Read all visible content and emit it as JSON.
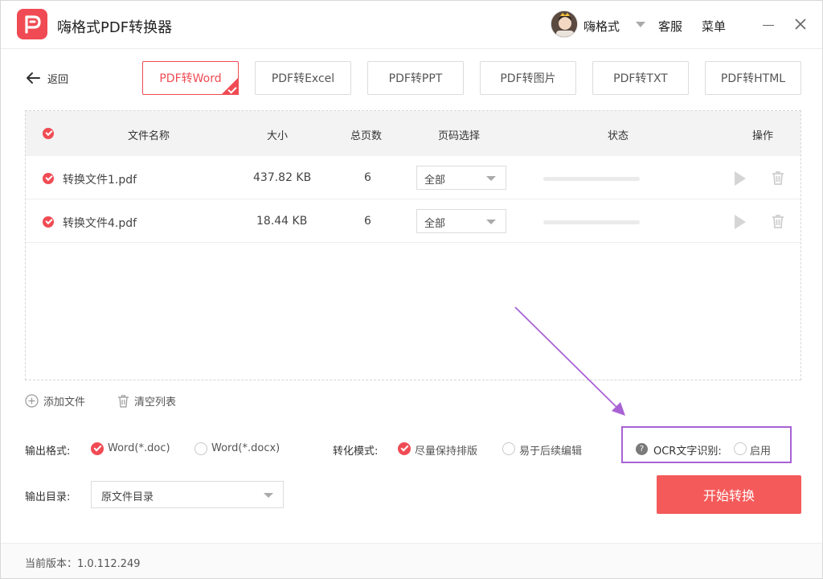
{
  "app": {
    "title": "嗨格式PDF转换器"
  },
  "header": {
    "user_name": "嗨格式",
    "service_label": "客服",
    "menu_label": "菜单"
  },
  "back_label": "返回",
  "tabs": [
    {
      "label": "PDF转Word",
      "active": true
    },
    {
      "label": "PDF转Excel",
      "active": false
    },
    {
      "label": "PDF转PPT",
      "active": false
    },
    {
      "label": "PDF转图片",
      "active": false
    },
    {
      "label": "PDF转TXT",
      "active": false
    },
    {
      "label": "PDF转HTML",
      "active": false
    }
  ],
  "table": {
    "headers": {
      "name": "文件名称",
      "size": "大小",
      "pages": "总页数",
      "page_select": "页码选择",
      "status": "状态",
      "actions": "操作"
    },
    "rows": [
      {
        "name": "转换文件1.pdf",
        "size": "437.82 KB",
        "pages": "6",
        "page_select": "全部",
        "progress": 0
      },
      {
        "name": "转换文件4.pdf",
        "size": "18.44 KB",
        "pages": "6",
        "page_select": "全部",
        "progress": 0
      }
    ]
  },
  "actions": {
    "add_file": "添加文件",
    "clear_list": "清空列表"
  },
  "options": {
    "output_format_label": "输出格式:",
    "format_doc": "Word(*.doc)",
    "format_docx": "Word(*.docx)",
    "mode_label": "转化模式:",
    "mode_keep_layout": "尽量保持排版",
    "mode_easy_edit": "易于后续编辑",
    "ocr_label": "OCR文字识别:",
    "ocr_enable": "启用",
    "output_dir_label": "输出目录:",
    "output_dir_value": "原文件目录"
  },
  "start_button": "开始转换",
  "footer": {
    "version": "当前版本：1.0.112.249"
  },
  "colors": {
    "accent": "#f04b54",
    "highlight": "#a862d4"
  }
}
